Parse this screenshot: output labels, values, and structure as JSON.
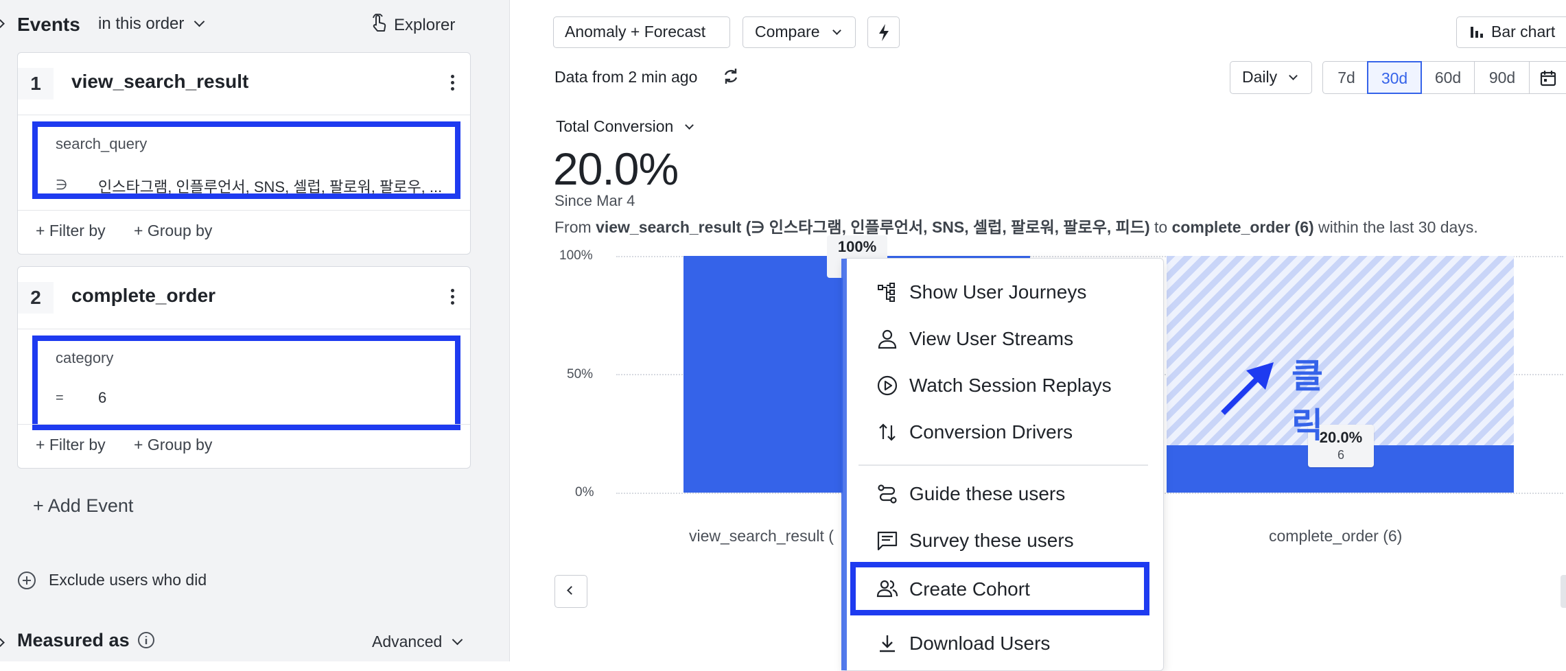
{
  "sidebar": {
    "events_title": "Events",
    "order_label": "in this order",
    "explorer_label": "Explorer",
    "events": [
      {
        "number": "1",
        "name": "view_search_result",
        "property": "search_query",
        "operator": "∋",
        "value": "인스타그램, 인플루언서, SNS, 셀럽, 팔로워, 팔로우, ..."
      },
      {
        "number": "2",
        "name": "complete_order",
        "property": "category",
        "operator": "=",
        "value": "6"
      }
    ],
    "filter_by": "+ Filter by",
    "group_by": "+ Group by",
    "add_event": "+ Add Event",
    "exclude_users": "Exclude users who did",
    "measured_as": "Measured as",
    "advanced": "Advanced"
  },
  "toolbar": {
    "anomaly_forecast": "Anomaly + Forecast",
    "compare": "Compare",
    "bar_chart": "Bar chart",
    "data_freshness": "Data from 2 min ago",
    "interval": "Daily",
    "ranges": [
      "7d",
      "30d",
      "60d",
      "90d"
    ],
    "active_range": "30d"
  },
  "summary": {
    "metric_label": "Total Conversion",
    "value": "20.0%",
    "since": "Since Mar 4",
    "desc_prefix": "From ",
    "desc_event1": "view_search_result",
    "desc_filter1": "(∋ 인스타그램, 인플루언서, SNS, 셀럽, 팔로워, 팔로우, 피드)",
    "desc_to": " to ",
    "desc_event2": "complete_order (6)",
    "desc_suffix": " within the last 30 days."
  },
  "chart_data": {
    "type": "bar",
    "categories": [
      "view_search_result (...",
      "complete_order (6)"
    ],
    "category_labels": [
      "view_search_result (",
      "complete_order (6)"
    ],
    "values": [
      100,
      20.0
    ],
    "y_ticks": [
      "100%",
      "50%",
      "0%"
    ],
    "ylim": [
      0,
      100
    ],
    "data_labels": [
      {
        "pct": "100%",
        "count": ""
      },
      {
        "pct": "20.0%",
        "count": "6"
      }
    ],
    "colors": {
      "bar": "#3563e9",
      "dropoff": "#c9d5f8"
    },
    "annotation": "클릭"
  },
  "context_menu": {
    "items": [
      {
        "label": "Show User Journeys",
        "icon": "journey-icon"
      },
      {
        "label": "View User Streams",
        "icon": "user-icon"
      },
      {
        "label": "Watch Session Replays",
        "icon": "play-icon"
      },
      {
        "label": "Conversion Drivers",
        "icon": "sort-arrows-icon"
      },
      {
        "label": "Guide these users",
        "icon": "route-icon"
      },
      {
        "label": "Survey these users",
        "icon": "message-icon"
      },
      {
        "label": "Create Cohort",
        "icon": "users-icon"
      },
      {
        "label": "Download Users",
        "icon": "download-icon"
      }
    ],
    "highlighted": "Create Cohort"
  },
  "colors": {
    "highlight": "#1e3bf0",
    "accent": "#3563e9",
    "panel_bg": "#f2f3f5"
  }
}
